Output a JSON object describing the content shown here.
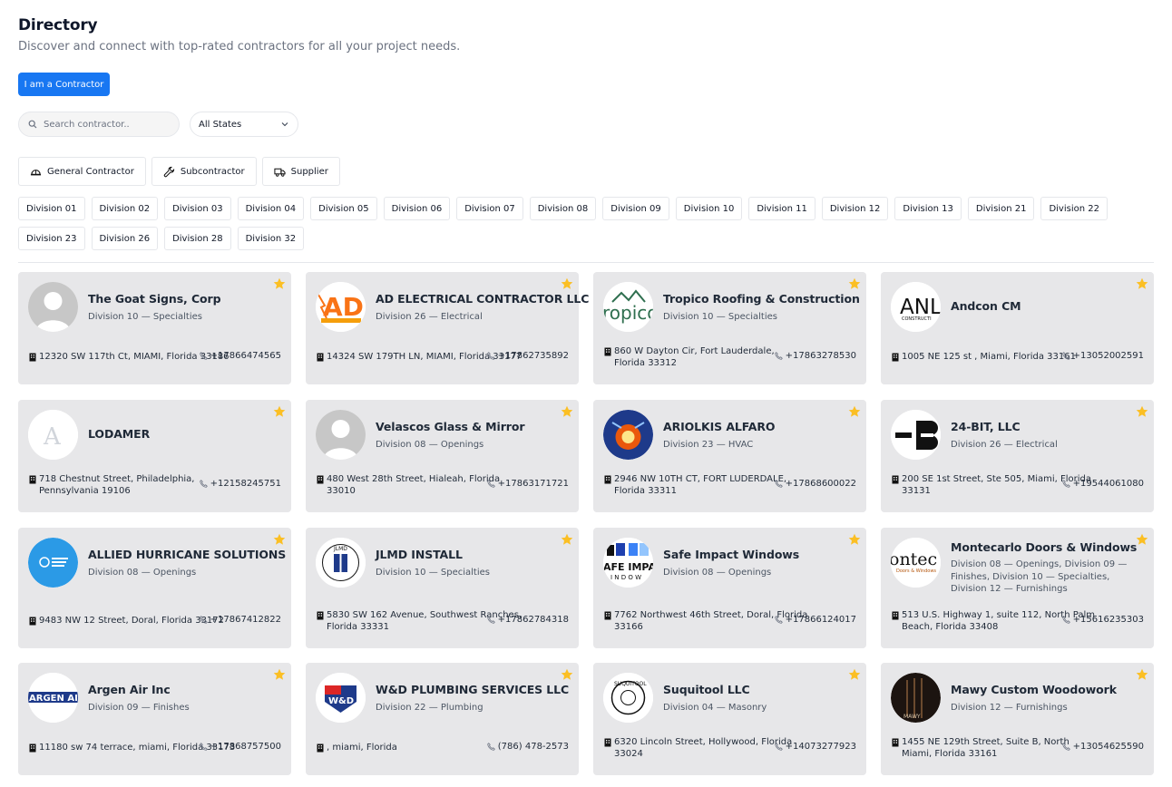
{
  "header": {
    "title": "Directory",
    "subtitle": "Discover and connect with top-rated contractors for all your project needs.",
    "cta_label": "I am a Contractor"
  },
  "filters": {
    "search_placeholder": "Search contractor..",
    "state_selected": "All States",
    "types": [
      {
        "label": "General Contractor",
        "icon": "hard-hat-icon"
      },
      {
        "label": "Subcontractor",
        "icon": "wrench-icon"
      },
      {
        "label": "Supplier",
        "icon": "truck-icon"
      }
    ],
    "divisions": [
      "Division 01",
      "Division 02",
      "Division 03",
      "Division 04",
      "Division 05",
      "Division 06",
      "Division 07",
      "Division 08",
      "Division 09",
      "Division 10",
      "Division 11",
      "Division 12",
      "Division 13",
      "Division 21",
      "Division 22",
      "Division 23",
      "Division 26",
      "Division 28",
      "Division 32"
    ]
  },
  "colors": {
    "accent": "#1877f2",
    "star": "#fbbf24",
    "card_bg": "#e7e7e9"
  },
  "contractors": [
    {
      "name": "The Goat Signs, Corp",
      "division": "Division 10 — Specialties",
      "address_lines": [
        "12320 SW 117th Ct, MIAMI, Florida 33186"
      ],
      "phone": "+17866474565",
      "logo": "default-avatar"
    },
    {
      "name": "AD ELECTRICAL CONTRACTOR LLC",
      "division": "Division 26 — Electrical",
      "address_lines": [
        "14324 SW 179TH LN, MIAMI, Florida 33177"
      ],
      "phone": "+17862735892",
      "logo": "AD"
    },
    {
      "name": "Tropico Roofing & Construction",
      "division": "Division 10 — Specialties",
      "address_lines": [
        "860 W Dayton Cir, Fort Lauderdale,",
        "Florida 33312"
      ],
      "phone": "+17863278530",
      "logo": "tropico"
    },
    {
      "name": "Andcon CM",
      "division": "",
      "address_lines": [
        "1005 NE 125 st , Miami, Florida 33161"
      ],
      "phone": "+13052002591",
      "logo": "ANL"
    },
    {
      "name": "LODAMER",
      "division": "",
      "address_lines": [
        "718 Chestnut Street, Philadelphia,",
        "Pennsylvania 19106"
      ],
      "phone": "+12158245751",
      "logo": "A"
    },
    {
      "name": "Velascos Glass & Mirror",
      "division": "Division 08 — Openings",
      "address_lines": [
        "480 West 28th Street, Hialeah, Florida",
        "33010"
      ],
      "phone": "+17863171721",
      "logo": "default-avatar"
    },
    {
      "name": "ARIOLKIS ALFARO",
      "division": "Division 23 — HVAC",
      "address_lines": [
        "2946 NW 10TH CT, FORT LUDERDALE,",
        "Florida 33311"
      ],
      "phone": "+17868600022",
      "logo": "fire-ice"
    },
    {
      "name": "24-BIT, LLC",
      "division": "Division 26 — Electrical",
      "address_lines": [
        "200 SE 1st Street, Ste 505, Miami, Florida",
        "33131"
      ],
      "phone": "+19544061080",
      "logo": "bit"
    },
    {
      "name": "ALLIED HURRICANE SOLUTIONS",
      "division": "Division 08 — Openings",
      "address_lines": [
        "9483 NW 12 Street, Doral, Florida 33172"
      ],
      "phone": "+17867412822",
      "logo": "allied"
    },
    {
      "name": "JLMD INSTALL",
      "division": "Division 10 — Specialties",
      "address_lines": [
        "5830 SW 162 Avenue, Southwest Ranches,",
        "Florida 33331"
      ],
      "phone": "+17862784318",
      "logo": "jlmd"
    },
    {
      "name": "Safe Impact Windows",
      "division": "Division 08 — Openings",
      "address_lines": [
        "7762 Northwest 46th Street, Doral, Florida",
        "33166"
      ],
      "phone": "+17866124017",
      "logo": "siw"
    },
    {
      "name": "Montecarlo Doors & Windows",
      "division": "Division 08 — Openings, Division 09 — Finishes, Division 10 — Specialties, Division 12 — Furnishings",
      "address_lines": [
        "513 U.S. Highway 1, suite 112, North Palm",
        "Beach, Florida 33408"
      ],
      "phone": "+15616235303",
      "logo": "ontec"
    },
    {
      "name": "Argen Air Inc",
      "division": "Division 09 — Finishes",
      "address_lines": [
        "11180 sw 74 terrace, miami, Florida 33173"
      ],
      "phone": "+17868757500",
      "logo": "argen"
    },
    {
      "name": "W&D PLUMBING SERVICES LLC",
      "division": "Division 22 — Plumbing",
      "address_lines": [
        ", miami, Florida"
      ],
      "phone": "(786) 478-2573",
      "logo": "wd"
    },
    {
      "name": "Suquitool LLC",
      "division": "Division 04 — Masonry",
      "address_lines": [
        "6320 Lincoln Street, Hollywood, Florida",
        "33024"
      ],
      "phone": "+14073277923",
      "logo": "suq"
    },
    {
      "name": "Mawy Custom Woodowork",
      "division": "Division 12 — Furnishings",
      "address_lines": [
        "1455 NE 129th Street, Suite B, North",
        "Miami, Florida 33161"
      ],
      "phone": "+13054625590",
      "logo": "wood"
    }
  ]
}
